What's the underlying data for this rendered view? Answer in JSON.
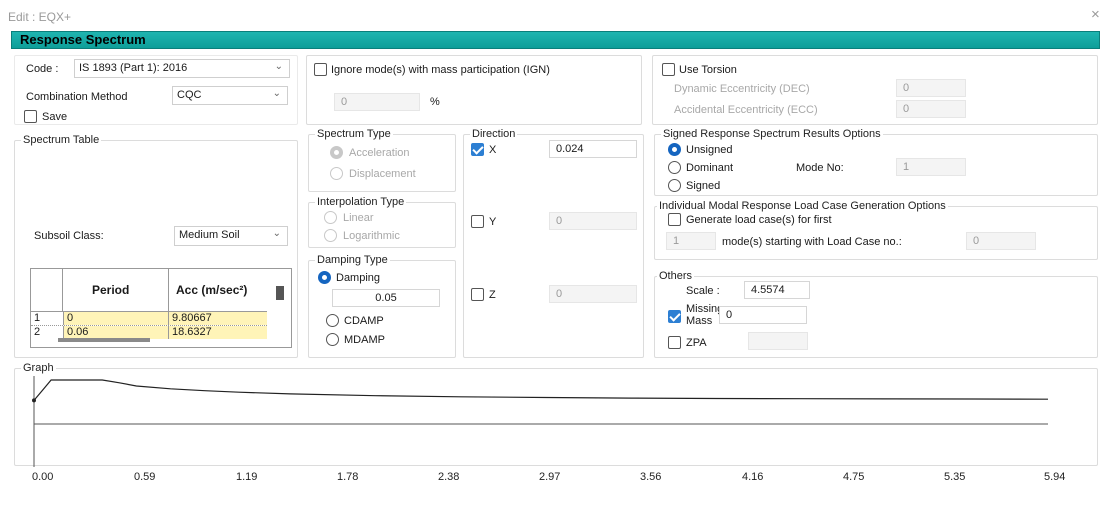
{
  "window": {
    "title": "Edit : EQX+",
    "close": "×"
  },
  "header": {
    "title": "Response Spectrum"
  },
  "code": {
    "label": "Code :",
    "value": "IS 1893 (Part 1): 2016"
  },
  "combination": {
    "label": "Combination Method",
    "value": "CQC"
  },
  "save": {
    "label": "Save",
    "checked": false
  },
  "ign": {
    "label": "Ignore mode(s) with mass participation (IGN)",
    "value": "0",
    "unit": "%",
    "checked": false
  },
  "torsion": {
    "label": "Use Torsion",
    "checked": false,
    "dec_label": "Dynamic Eccentricity (DEC)",
    "dec_value": "0",
    "ecc_label": "Accidental Eccentricity (ECC)",
    "ecc_value": "0"
  },
  "spectrum_table": {
    "title": "Spectrum Table",
    "subsoil_label": "Subsoil Class:",
    "subsoil_value": "Medium Soil",
    "headers": [
      "Period",
      "Acc (m/sec²)"
    ],
    "rows": [
      {
        "n": "1",
        "period": "0",
        "acc": "9.80667"
      },
      {
        "n": "2",
        "period": "0.06",
        "acc": "18.6327"
      }
    ]
  },
  "spectrum_type": {
    "title": "Spectrum Type",
    "options": [
      "Acceleration",
      "Displacement"
    ]
  },
  "interpolation": {
    "title": "Interpolation Type",
    "options": [
      "Linear",
      "Logarithmic"
    ]
  },
  "damping": {
    "title": "Damping Type",
    "options": [
      "Damping",
      "CDAMP",
      "MDAMP"
    ],
    "value": "0.05"
  },
  "direction": {
    "title": "Direction",
    "x": {
      "label": "X",
      "checked": true,
      "value": "0.024"
    },
    "y": {
      "label": "Y",
      "checked": false,
      "value": "0"
    },
    "z": {
      "label": "Z",
      "checked": false,
      "value": "0"
    }
  },
  "signed": {
    "title": "Signed Response Spectrum Results Options",
    "options": [
      "Unsigned",
      "Dominant",
      "Signed"
    ],
    "mode_label": "Mode No:",
    "mode_value": "1"
  },
  "individual": {
    "title": "Individual Modal Response Load Case Generation Options",
    "gen_label": "Generate load case(s) for  first",
    "count_value": "1",
    "start_label": "mode(s) starting with Load Case no.:",
    "start_value": "0"
  },
  "others": {
    "title": "Others",
    "scale_label": "Scale :",
    "scale_value": "4.5574",
    "missing_label_1": "Missing",
    "missing_label_2": "Mass",
    "missing_checked": true,
    "missing_value": "0",
    "zpa_label": "ZPA",
    "zpa_checked": false
  },
  "graph": {
    "title": "Graph",
    "x_ticks": [
      "0.00",
      "0.59",
      "1.19",
      "1.78",
      "2.38",
      "2.97",
      "3.56",
      "4.16",
      "4.75",
      "5.35",
      "5.94"
    ]
  },
  "chart_data": {
    "type": "line",
    "xlim": [
      0,
      5.94
    ],
    "x_ticks": [
      0.0,
      0.59,
      1.19,
      1.78,
      2.38,
      2.97,
      3.56,
      4.16,
      4.75,
      5.35,
      5.94
    ],
    "series": [
      {
        "x": [
          0,
          0.06,
          0.1,
          0.4,
          0.5,
          0.6,
          0.8,
          1.0,
          1.2,
          1.5,
          2.0,
          2.5,
          3.0,
          3.5,
          4.0,
          4.5,
          5.0,
          5.5,
          5.94
        ],
        "y": [
          9.81,
          18.63,
          24.52,
          24.52,
          22.5,
          20.2,
          18.2,
          16.8,
          15.7,
          14.5,
          13.2,
          12.4,
          11.9,
          11.5,
          11.2,
          11.0,
          10.9,
          10.8,
          10.7
        ]
      }
    ]
  },
  "colors": {
    "accent": "#0e9e99",
    "check": "#2d7fd3",
    "row_highlight": "#fff4b8"
  }
}
